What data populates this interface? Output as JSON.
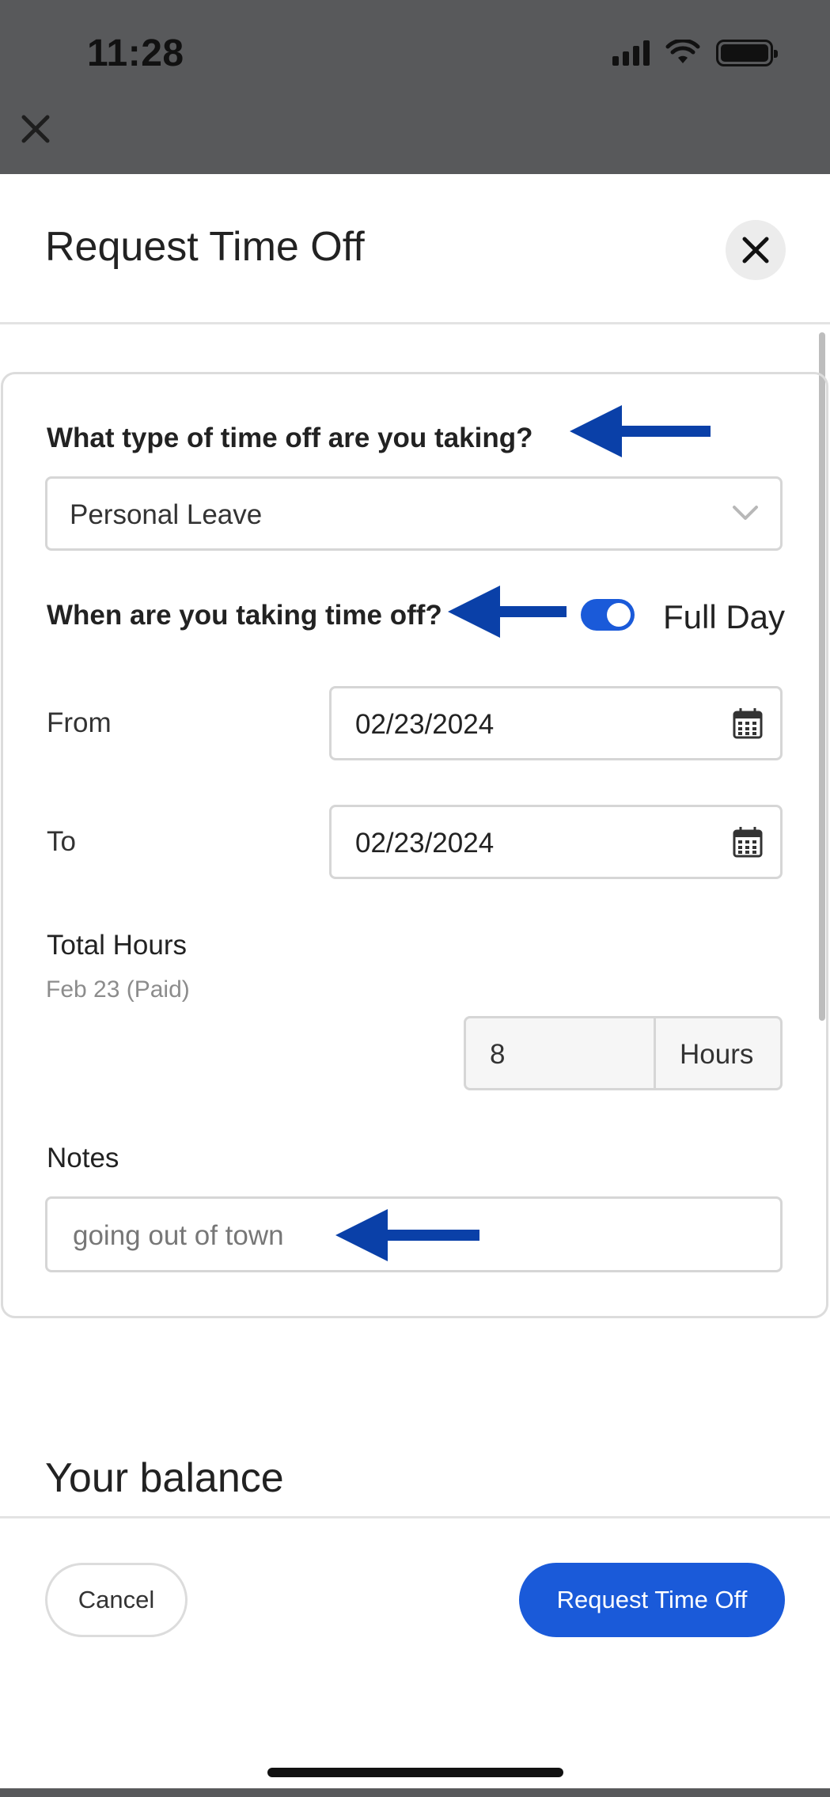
{
  "status_bar": {
    "time": "11:28"
  },
  "header": {
    "title": "Request Time Off"
  },
  "form": {
    "type_question": "What type of time off are you taking?",
    "type_selected": "Personal Leave",
    "when_question": "When are you taking time off?",
    "full_day_label": "Full Day",
    "full_day_on": true,
    "from_label": "From",
    "from_value": "02/23/2024",
    "to_label": "To",
    "to_value": "02/23/2024",
    "total_hours_label": "Total Hours",
    "total_hours_sub": "Feb 23 (Paid)",
    "hours_value": "8",
    "hours_unit": "Hours",
    "notes_label": "Notes",
    "notes_value": "going out of town"
  },
  "balance": {
    "title": "Your balance"
  },
  "footer": {
    "cancel_label": "Cancel",
    "submit_label": "Request Time Off"
  },
  "colors": {
    "accent": "#1a5ad9",
    "annotation_arrow": "#0a40a8",
    "overlay": "#58595b"
  },
  "icons": [
    "close-icon",
    "chevron-down-icon",
    "calendar-icon",
    "arrow-left-icon"
  ]
}
